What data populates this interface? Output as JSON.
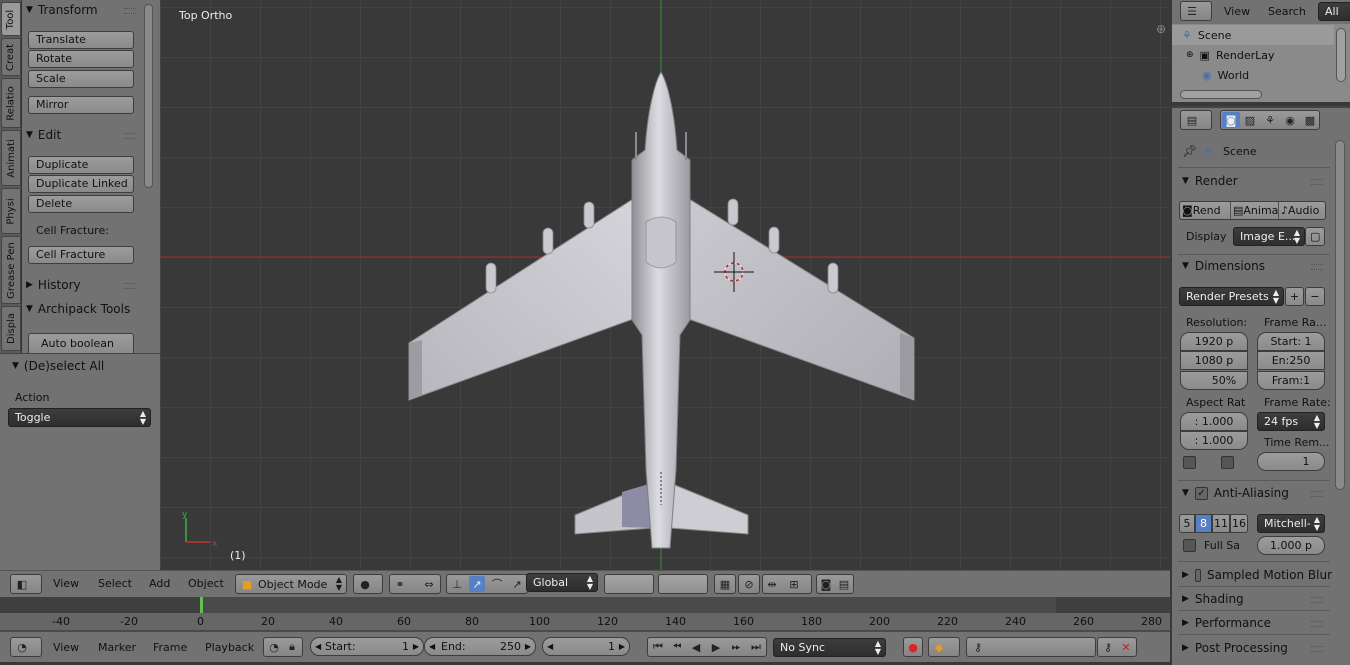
{
  "viewport": {
    "title": "Top Ortho",
    "frame_label": "(1)"
  },
  "tool_tabs": [
    "Tool",
    "Creat",
    "Relatio",
    "Animati",
    "Physi",
    "Grease Pen",
    "Displa"
  ],
  "tool_shelf": {
    "transform_title": "Transform",
    "translate": "Translate",
    "rotate": "Rotate",
    "scale": "Scale",
    "mirror": "Mirror",
    "edit_title": "Edit",
    "duplicate": "Duplicate",
    "duplicate_linked": "Duplicate Linked",
    "delete": "Delete",
    "cell_fracture_label": "Cell Fracture:",
    "cell_fracture": "Cell Fracture",
    "history_title": "History",
    "archipack_title": "Archipack Tools",
    "auto_boolean": "Auto boolean"
  },
  "operator_panel": {
    "title": "(De)select All",
    "action_label": "Action",
    "action_value": "Toggle"
  },
  "view_header": {
    "view": "View",
    "select": "Select",
    "add": "Add",
    "object": "Object",
    "mode": "Object Mode",
    "orientation": "Global"
  },
  "timeline": {
    "ticks": [
      "-40",
      "-20",
      "0",
      "20",
      "40",
      "60",
      "80",
      "100",
      "120",
      "140",
      "160",
      "180",
      "200",
      "220",
      "240",
      "260",
      "280"
    ]
  },
  "timeline_header": {
    "view": "View",
    "marker": "Marker",
    "frame": "Frame",
    "playback": "Playback",
    "start_label": "Start:",
    "start_value": "1",
    "end_label": "End:",
    "end_value": "250",
    "current_frame": "1",
    "sync": "No Sync"
  },
  "outliner": {
    "view": "View",
    "search": "Search",
    "filter": "All Sc",
    "rows": [
      "Scene",
      "RenderLay",
      "World"
    ]
  },
  "properties": {
    "scene": "Scene",
    "render_title": "Render",
    "render_btn": "Rend",
    "anim_btn": "Anima",
    "audio_btn": "Audio",
    "display_label": "Display",
    "display_value": "Image E...",
    "dimensions_title": "Dimensions",
    "render_presets": "Render Presets",
    "resolution_label": "Resolution:",
    "res_x": "1920 p",
    "res_y": "1080 p",
    "res_pct": "50%",
    "frame_range_label": "Frame Ra...",
    "frame_start": "Start: 1",
    "frame_end": "En:250",
    "frame_step": "Fram:1",
    "aspect_label": "Aspect Rat",
    "aspect_x": ": 1.000",
    "aspect_y": ": 1.000",
    "frame_rate_label": "Frame Rate:",
    "frame_rate": "24 fps",
    "time_remap_label": "Time Rem...",
    "time_remap_value": "1",
    "aa_title": "Anti-Aliasing",
    "aa_samples": [
      "5",
      "8",
      "11",
      "16"
    ],
    "aa_filter": "Mitchell-",
    "full_sample": "Full Sa",
    "filter_size": "1.000 p",
    "motion_blur_title": "Sampled Motion Blur",
    "shading_title": "Shading",
    "performance_title": "Performance",
    "post_processing_title": "Post Processing"
  },
  "colors": {
    "accent": "#5680c2",
    "timeline_cursor": "#5fc24a",
    "axis_x": "#a52a2a",
    "axis_y": "#2e8b2e"
  }
}
